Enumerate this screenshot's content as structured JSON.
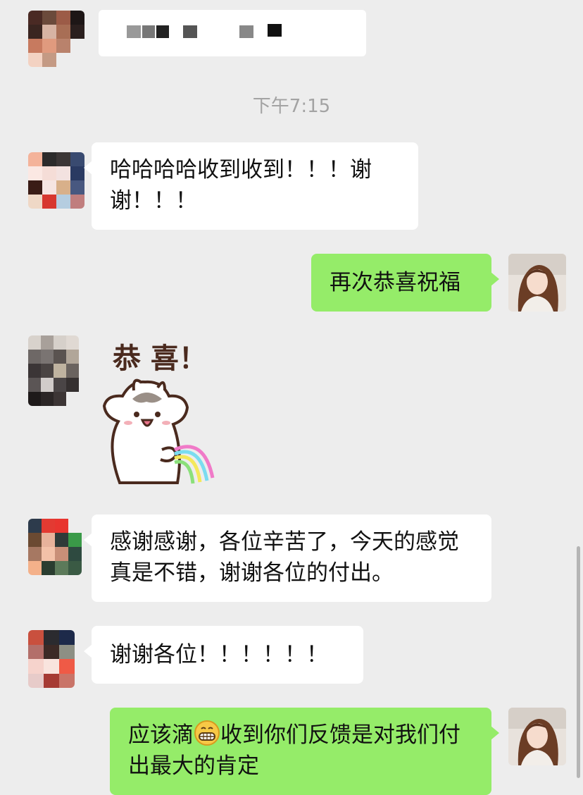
{
  "chat": {
    "timestamp": "下午7:15",
    "messages": [
      {
        "from": "other",
        "text": "哈哈哈哈收到收到！！！谢谢！！！"
      },
      {
        "from": "self",
        "text": "再次恭喜祝福"
      },
      {
        "from": "other",
        "type": "sticker",
        "sticker": "hamster-rainbow-congrats-sticker",
        "sticker_text": "恭 喜！"
      },
      {
        "from": "other",
        "text": "感谢感谢，各位辛苦了，今天的感觉真是不错，谢谢各位的付出。"
      },
      {
        "from": "other",
        "text": "谢谢各位！！！！！！"
      },
      {
        "from": "self",
        "text_before": "应该滴",
        "emoji": "grinning-face-emoji",
        "text_after": "收到你们反馈是对我们付出最大的肯定"
      }
    ]
  },
  "colors": {
    "background": "#ededed",
    "incoming_bubble": "#ffffff",
    "outgoing_bubble": "#95ec69",
    "timestamp_text": "#a3a3a3"
  }
}
